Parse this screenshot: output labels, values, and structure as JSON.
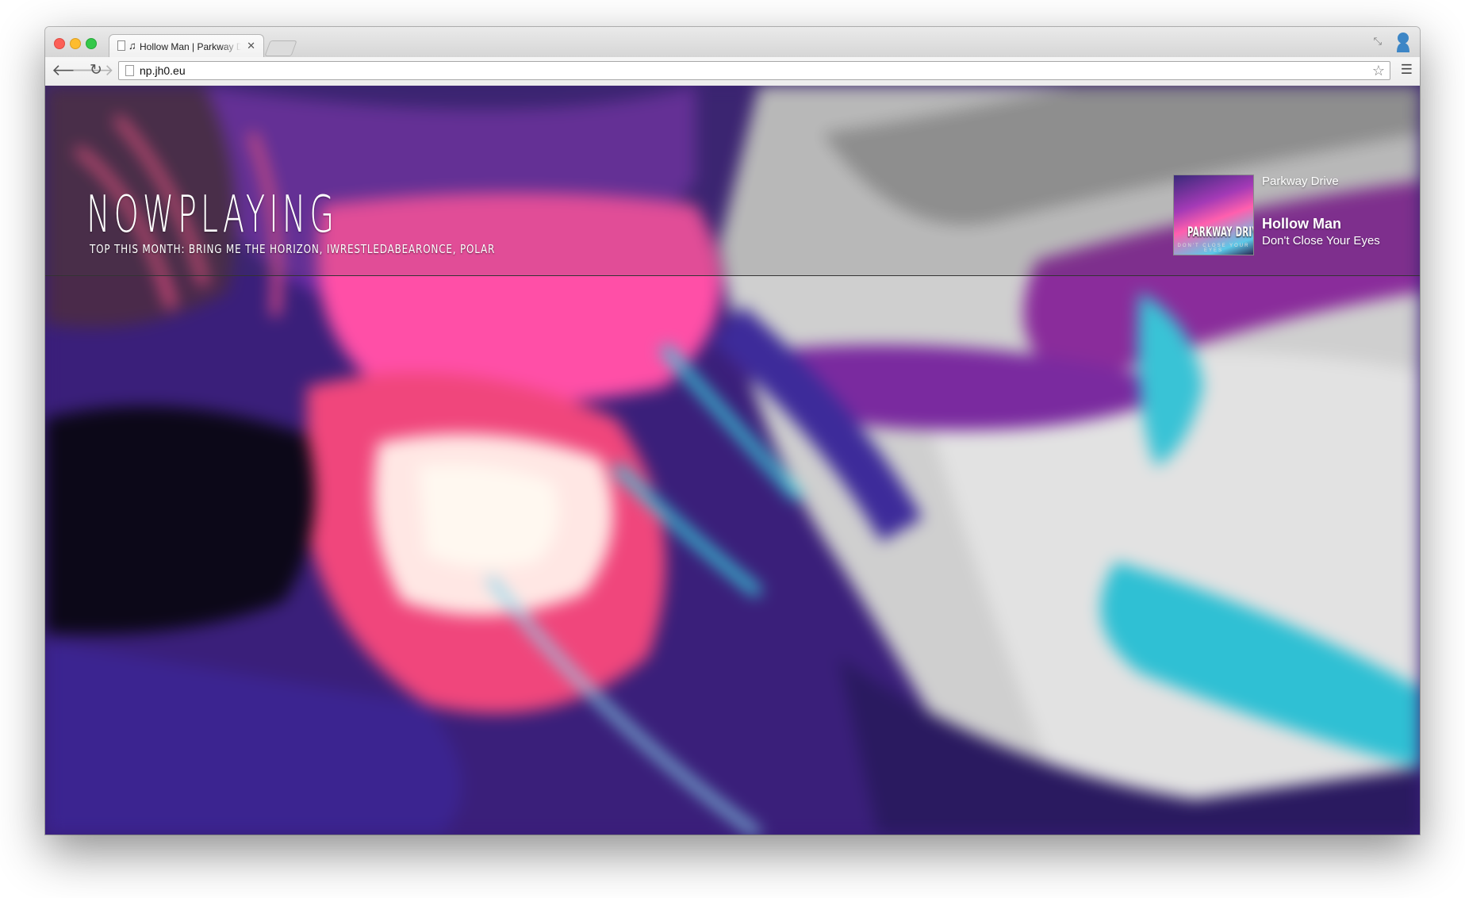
{
  "browser": {
    "tab_title": "Hollow Man | Parkway Drive",
    "tab_note_glyph": "♫",
    "url": "np.jh0.eu"
  },
  "icons": {
    "back": "back-arrow-icon",
    "forward": "forward-arrow-icon",
    "reload": "reload-icon",
    "star": "bookmark-star-icon",
    "menu": "hamburger-menu-icon",
    "close": "close-icon"
  },
  "site": {
    "logo": "NOWPLAYING",
    "top_this_month": "TOP THIS MONTH: BRING ME THE HORIZON, IWRESTLEDABEARONCE, POLAR"
  },
  "now_playing": {
    "artist": "Parkway Drive",
    "track": "Hollow Man",
    "album": "Don't Close Your Eyes",
    "cover_text": "PARKWAY DRIVE",
    "cover_subtext": "DON'T CLOSE YOUR EYES"
  },
  "colors": {
    "traffic_red": "#fc5f57",
    "traffic_yellow": "#fdbc2e",
    "traffic_green": "#34c84a",
    "bg_purple": "#3a1f7a",
    "bg_magenta": "#e8357e",
    "bg_cyan": "#39c3d6",
    "bg_grey": "#c8c8c8"
  }
}
